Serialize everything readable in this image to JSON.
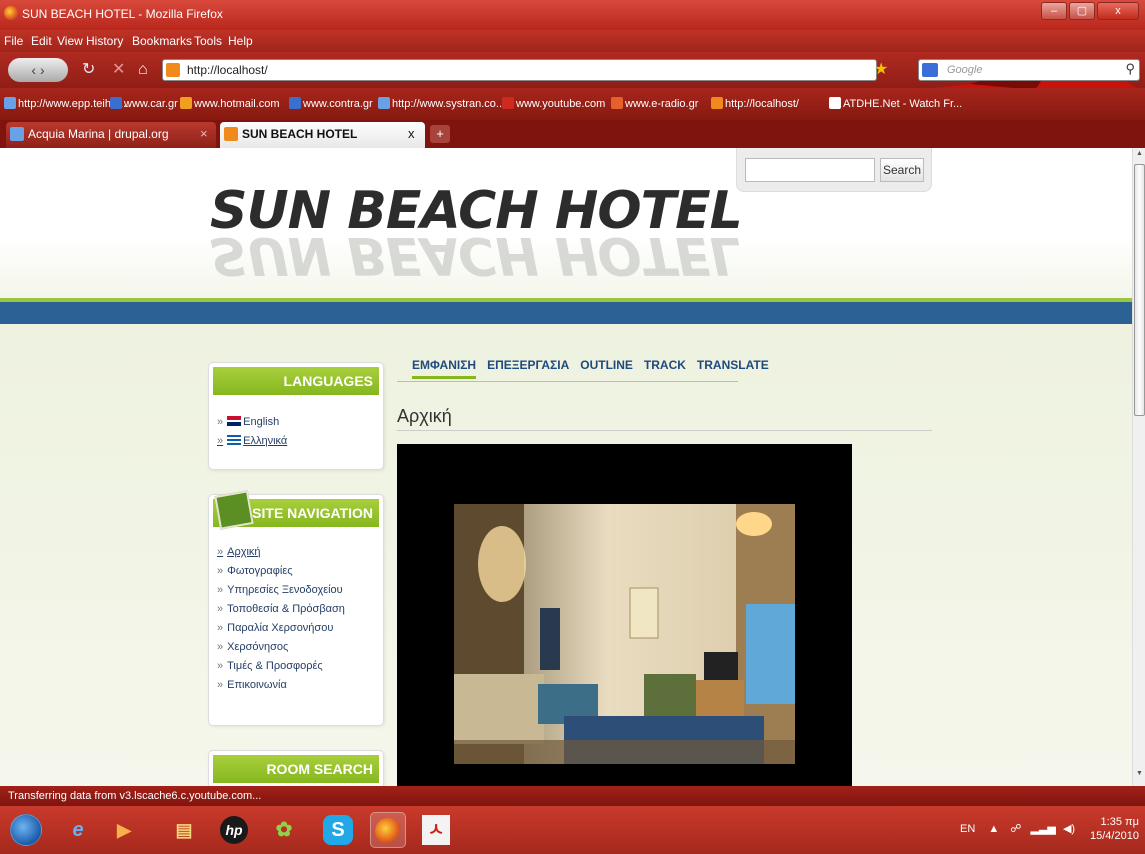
{
  "window": {
    "title": "SUN BEACH HOTEL - Mozilla Firefox",
    "controls": [
      "–",
      "▢",
      "x"
    ]
  },
  "menu": [
    "File",
    "Edit",
    "View",
    "History",
    "Bookmarks",
    "Tools",
    "Help"
  ],
  "toolbar": {
    "url": "http://localhost/",
    "search_placeholder": "Google"
  },
  "bookmarks": [
    {
      "label": "http://www.epp.teiher...",
      "color": "#6aa0e6"
    },
    {
      "label": "www.car.gr",
      "color": "#3a6fd1"
    },
    {
      "label": "www.hotmail.com",
      "color": "#f0a020"
    },
    {
      "label": "www.contra.gr",
      "color": "#3a6fd1"
    },
    {
      "label": "http://www.systran.co...",
      "color": "#6aa0e6"
    },
    {
      "label": "www.youtube.com",
      "color": "#d02a20"
    },
    {
      "label": "www.e-radio.gr",
      "color": "#e6602a"
    },
    {
      "label": "http://localhost/",
      "color": "#f08a1c"
    },
    {
      "label": "ATDHE.Net - Watch Fr...",
      "color": "#ffffff"
    }
  ],
  "tabs": [
    {
      "label": "Acquia Marina | drupal.org",
      "close": "×",
      "active": false
    },
    {
      "label": "SUN BEACH HOTEL",
      "close": "x",
      "active": true
    }
  ],
  "newtab": "+",
  "site": {
    "logo": "SUN BEACH HOTEL",
    "search_button": "Search",
    "languages": {
      "title": "LANGUAGES",
      "items": [
        "English",
        "Ελληνικά"
      ]
    },
    "navigation": {
      "title": "SITE NAVIGATION",
      "items": [
        "Αρχική",
        "Φωτογραφίες",
        "Υπηρεσίες Ξενοδοχείου",
        "Τοποθεσία & Πρόσβαση",
        "Παραλία Χερσονήσου",
        "Χερσόνησος",
        "Τιμές & Προσφορές",
        "Επικοινωνία"
      ]
    },
    "room_search": {
      "title": "ROOM SEARCH"
    },
    "content_tabs": [
      "ΕΜΦΑΝΙΣΗ",
      "ΕΠΕΞΕΡΓΑΣΙΑ",
      "OUTLINE",
      "TRACK",
      "TRANSLATE"
    ],
    "page_title": "Αρχική"
  },
  "status": "Transferring data from v3.lscache6.c.youtube.com...",
  "taskbar": {
    "language": "EN",
    "time": "1:35 πμ",
    "date": "15/4/2010",
    "apps": [
      "ie-icon",
      "media-player-icon",
      "explorer-icon",
      "hp-icon",
      "paint-icon",
      "skype-icon",
      "firefox-icon",
      "acrobat-icon"
    ]
  }
}
